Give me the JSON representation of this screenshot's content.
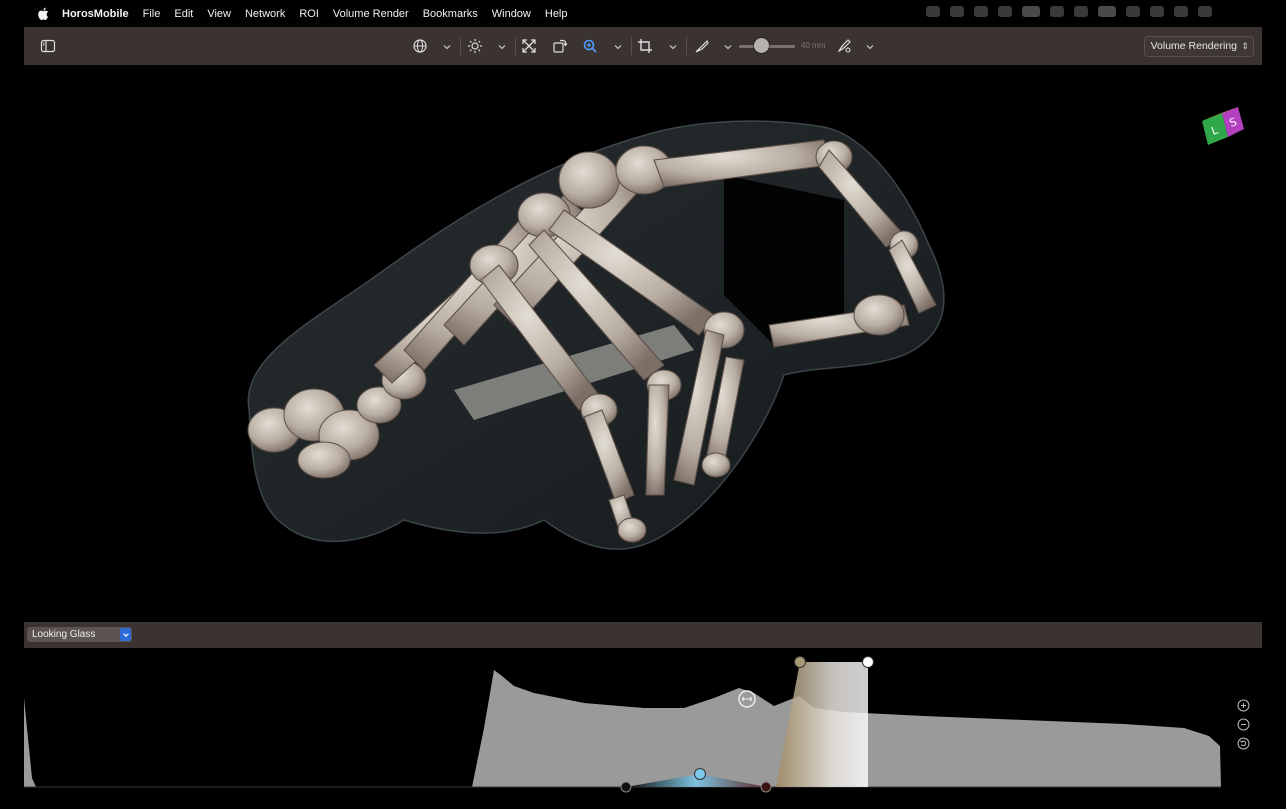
{
  "menubar": {
    "app_name": "HorosMobile",
    "items": [
      "File",
      "Edit",
      "View",
      "Network",
      "ROI",
      "Volume Render",
      "Bookmarks",
      "Window",
      "Help"
    ]
  },
  "toolbar": {
    "thickness_value": "40 mm",
    "mode_label": "Volume Rendering",
    "active_tool": "zoom"
  },
  "viewport": {
    "orientation_cube": {
      "left_label": "L",
      "right_label": "S"
    }
  },
  "transfer_function": {
    "preset_label": "Looking Glass"
  },
  "colors": {
    "toolbar_bg": "#3b3331",
    "accent": "#2f6bd8",
    "histogram": "#9a9a9a",
    "active_icon": "#4a9cff"
  }
}
